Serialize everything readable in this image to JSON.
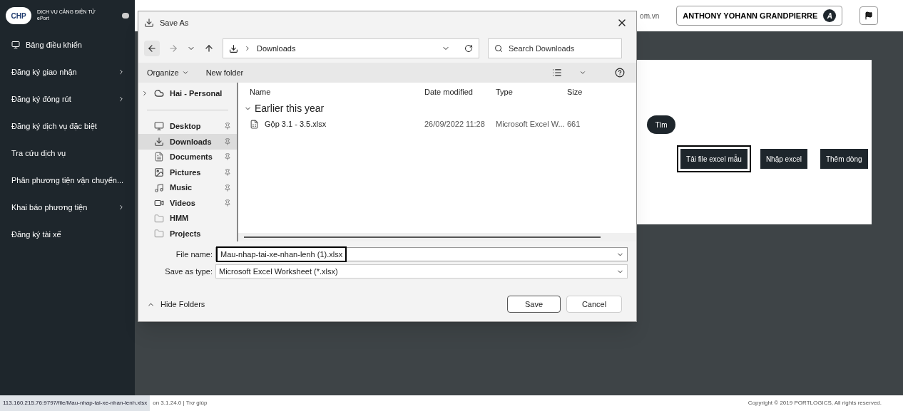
{
  "sidebar": {
    "logo": {
      "mark": "CHP",
      "title": "DỊCH VỤ CẢNG ĐIỆN TỬ",
      "subtitle": "ePort"
    },
    "items": [
      {
        "label": "Bảng điều khiển",
        "kind": "dashboard",
        "submenu": false
      },
      {
        "label": "Đăng ký giao nhận",
        "kind": "plain",
        "submenu": true
      },
      {
        "label": "Đăng ký đóng rút",
        "kind": "plain",
        "submenu": true
      },
      {
        "label": "Đăng ký dịch vụ đặc biệt",
        "kind": "plain",
        "submenu": false
      },
      {
        "label": "Tra cứu dịch vụ",
        "kind": "plain",
        "submenu": false
      },
      {
        "label": "Phân phương tiện vận chuyển...",
        "kind": "plain",
        "submenu": false
      },
      {
        "label": "Khai báo phương tiện",
        "kind": "plain",
        "submenu": true
      },
      {
        "label": "Đăng ký tài xế",
        "kind": "plain",
        "submenu": false
      }
    ]
  },
  "header": {
    "site_fragment": "om.vn",
    "user": {
      "name": "ANTHONY YOHANN GRANDPIERRE",
      "initial": "A"
    }
  },
  "card": {
    "search_button": "Tìm",
    "buttons": [
      {
        "label": "Tải file excel mẫu",
        "highlighted": true
      },
      {
        "label": "Nhập excel",
        "highlighted": false
      },
      {
        "label": "Thêm dòng",
        "highlighted": false
      }
    ]
  },
  "footer": {
    "link_preview": "113.160.215.76:9797/file/Mau-nhap-tai-xe-nhan-lenh.xlsx",
    "version": "on 3.1.24.0 | Trợ giúp",
    "copyright": "Copyright © 2019 PORTLOGICS, All rights reserved."
  },
  "dialog": {
    "title": "Save As",
    "address": "Downloads",
    "search": {
      "placeholder": "Search Downloads"
    },
    "toolbar": {
      "organize": "Organize",
      "new_folder": "New folder"
    },
    "nav": [
      {
        "label": "Hai - Personal",
        "kind": "cloud",
        "pinned": false,
        "selected": false,
        "expandable": true
      },
      {
        "label": "Desktop",
        "kind": "desktop",
        "pinned": true,
        "selected": false,
        "expandable": false
      },
      {
        "label": "Downloads",
        "kind": "downloads",
        "pinned": true,
        "selected": true,
        "expandable": false
      },
      {
        "label": "Documents",
        "kind": "documents",
        "pinned": true,
        "selected": false,
        "expandable": false
      },
      {
        "label": "Pictures",
        "kind": "pictures",
        "pinned": true,
        "selected": false,
        "expandable": false
      },
      {
        "label": "Music",
        "kind": "music",
        "pinned": true,
        "selected": false,
        "expandable": false
      },
      {
        "label": "Videos",
        "kind": "videos",
        "pinned": true,
        "selected": false,
        "expandable": false
      },
      {
        "label": "HMM",
        "kind": "folder",
        "pinned": false,
        "selected": false,
        "expandable": false
      },
      {
        "label": "Projects",
        "kind": "folder",
        "pinned": false,
        "selected": false,
        "expandable": false
      }
    ],
    "columns": [
      "Name",
      "Date modified",
      "Type",
      "Size"
    ],
    "group": "Earlier this year",
    "rows": [
      {
        "name": "Gộp 3.1 - 3.5.xlsx",
        "date": "26/09/2022 11:28",
        "type": "Microsoft Excel W...",
        "size": "661"
      }
    ],
    "file_name": {
      "label": "File name:",
      "value": "Mau-nhap-tai-xe-nhan-lenh (1).xlsx",
      "highlighted": true
    },
    "save_type": {
      "label": "Save as type:",
      "value": "Microsoft Excel Worksheet (*.xlsx)"
    },
    "hide_folders": "Hide Folders",
    "save": "Save",
    "cancel": "Cancel"
  }
}
